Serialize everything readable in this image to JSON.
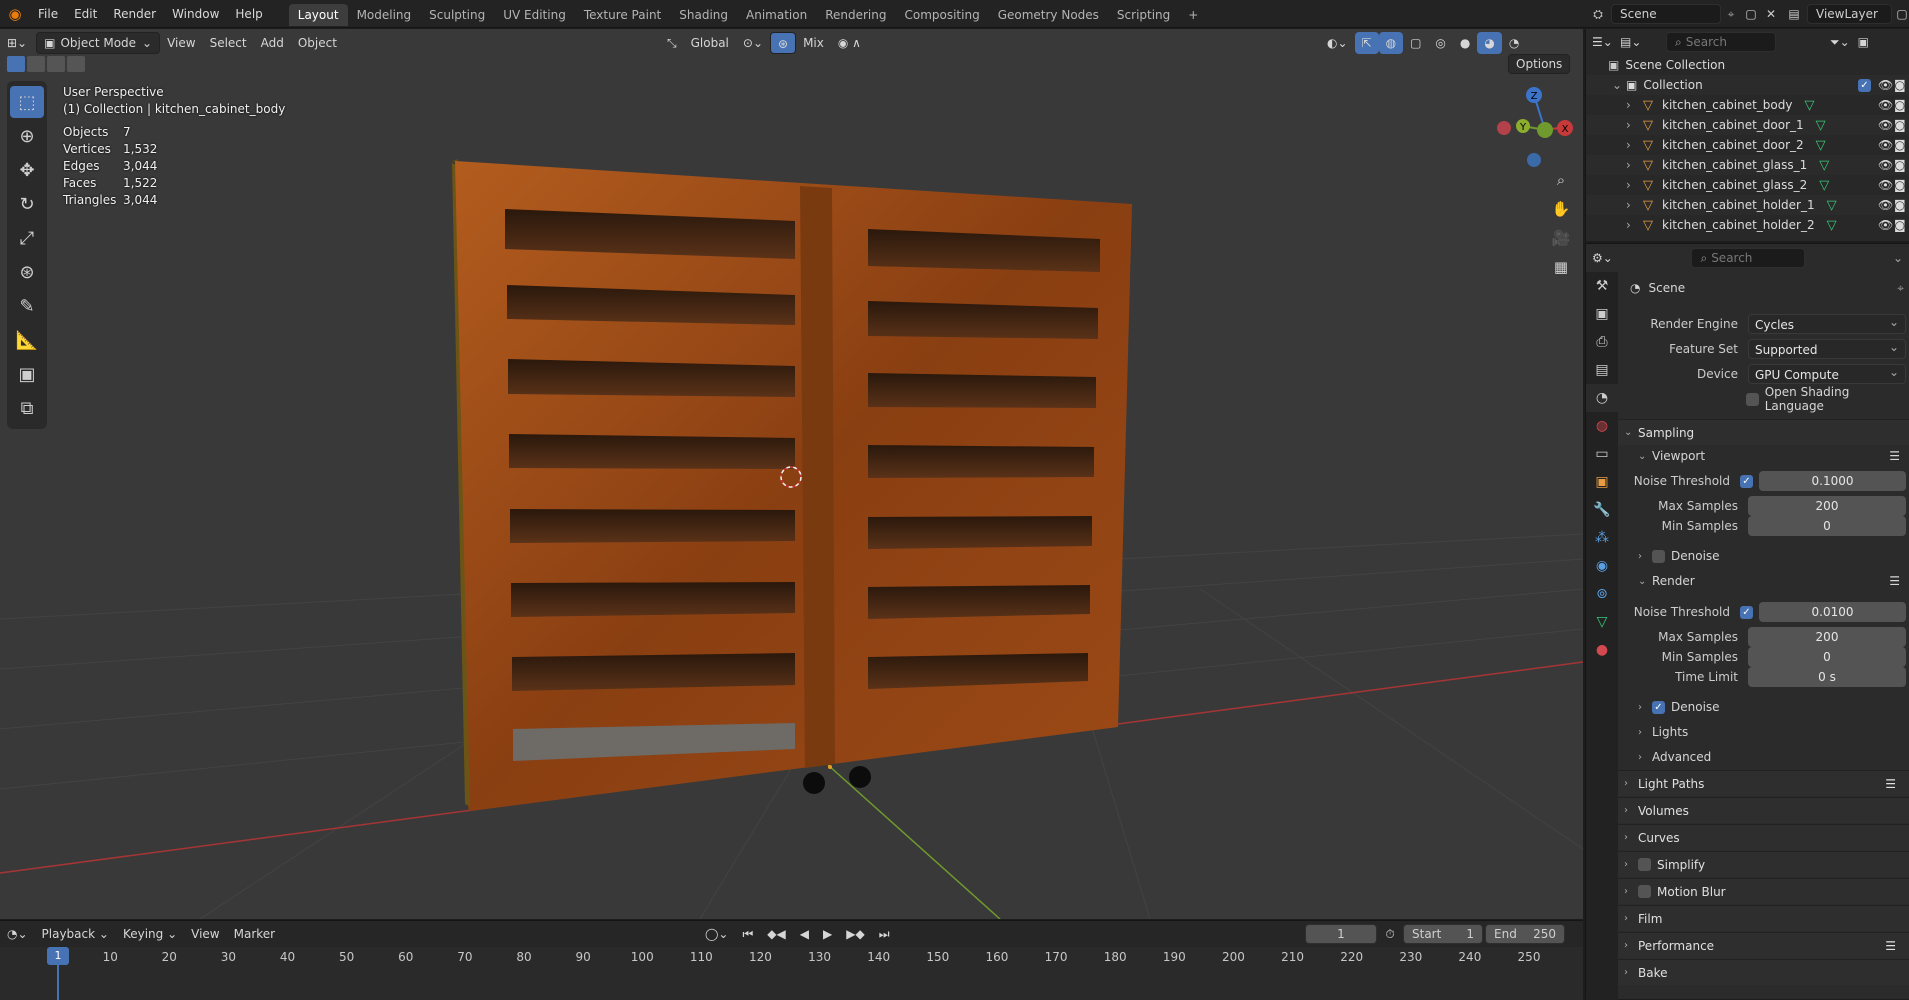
{
  "topbar": {
    "menus": [
      "File",
      "Edit",
      "Render",
      "Window",
      "Help"
    ],
    "workspaces": [
      "Layout",
      "Modeling",
      "Sculpting",
      "UV Editing",
      "Texture Paint",
      "Shading",
      "Animation",
      "Rendering",
      "Compositing",
      "Geometry Nodes",
      "Scripting"
    ],
    "active_workspace": "Layout",
    "add_tab": "+",
    "scene_name": "Scene",
    "view_layer": "ViewLayer"
  },
  "viewport": {
    "mode": "Object Mode",
    "menus": [
      "View",
      "Select",
      "Add",
      "Object"
    ],
    "orientation": "Global",
    "snap_mode": "Mix",
    "options_label": "Options",
    "perspective": "User Perspective",
    "collection_info": "(1) Collection | kitchen_cabinet_body",
    "stats": [
      {
        "label": "Objects",
        "value": "7"
      },
      {
        "label": "Vertices",
        "value": "1,532"
      },
      {
        "label": "Edges",
        "value": "3,044"
      },
      {
        "label": "Faces",
        "value": "1,522"
      },
      {
        "label": "Triangles",
        "value": "3,044"
      }
    ],
    "gizmo": {
      "x": "X",
      "y": "Y",
      "z": "Z"
    },
    "colors": {
      "x_axis": "#c83a3a",
      "y_axis": "#6f9a2d",
      "z_axis": "#3b74c9",
      "wood": "#9a4a17"
    }
  },
  "timeline": {
    "menus": [
      "Playback",
      "Keying",
      "View",
      "Marker"
    ],
    "current_frame": "1",
    "start_label": "Start",
    "start": "1",
    "end_label": "End",
    "end": "250",
    "ticks": [
      "1",
      "10",
      "20",
      "30",
      "40",
      "50",
      "60",
      "70",
      "80",
      "90",
      "100",
      "110",
      "120",
      "130",
      "140",
      "150",
      "160",
      "170",
      "180",
      "190",
      "200",
      "210",
      "220",
      "230",
      "240",
      "250"
    ]
  },
  "outliner": {
    "search_placeholder": "Search",
    "scene_collection": "Scene Collection",
    "collection": "Collection",
    "objects": [
      "kitchen_cabinet_body",
      "kitchen_cabinet_door_1",
      "kitchen_cabinet_door_2",
      "kitchen_cabinet_glass_1",
      "kitchen_cabinet_glass_2",
      "kitchen_cabinet_holder_1",
      "kitchen_cabinet_holder_2"
    ]
  },
  "properties": {
    "search_placeholder": "Search",
    "context": "Scene",
    "render_engine_label": "Render Engine",
    "render_engine": "Cycles",
    "feature_set_label": "Feature Set",
    "feature_set": "Supported",
    "device_label": "Device",
    "device": "GPU Compute",
    "osl_label": "Open Shading Language",
    "sampling": "Sampling",
    "viewport_section": "Viewport",
    "noise_threshold_label": "Noise Threshold",
    "viewport_noise": "0.1000",
    "max_samples_label": "Max Samples",
    "viewport_max": "200",
    "min_samples_label": "Min Samples",
    "viewport_min": "0",
    "denoise_label": "Denoise",
    "render_section": "Render",
    "render_noise": "0.0100",
    "render_max": "200",
    "render_min": "0",
    "time_limit_label": "Time Limit",
    "time_limit": "0 s",
    "lights": "Lights",
    "advanced": "Advanced",
    "panels": [
      "Light Paths",
      "Volumes",
      "Curves",
      "Simplify",
      "Motion Blur",
      "Film",
      "Performance",
      "Bake"
    ]
  }
}
